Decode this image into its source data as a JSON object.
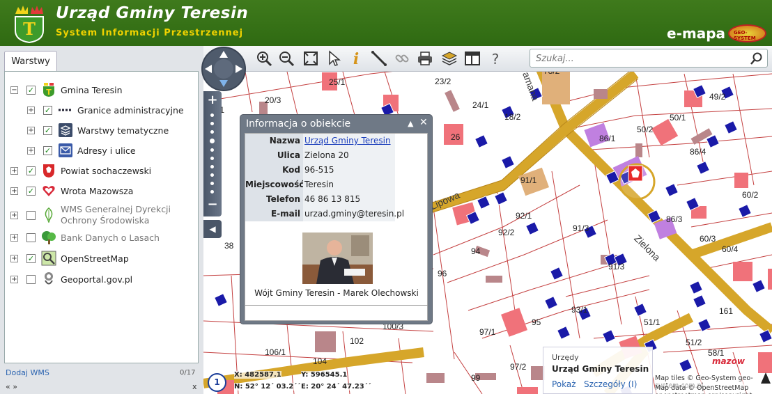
{
  "header": {
    "title": "Urząd Gminy Teresin",
    "subtitle": "System Informacji Przestrzennej",
    "brand": "e-mapa",
    "brand_badge": "GEO-SYSTEM"
  },
  "left_panel": {
    "tab": "Warstwy",
    "layers": [
      {
        "label": "Gmina Teresin",
        "expanded": true,
        "checked": true,
        "icon": "teresin-crest-icon"
      },
      {
        "label": "Granice administracyjne",
        "checked": true,
        "icon": "boundary-line-icon"
      },
      {
        "label": "Warstwy tematyczne",
        "checked": true,
        "icon": "layers-stack-icon"
      },
      {
        "label": "Adresy i ulice",
        "checked": true,
        "icon": "envelope-icon"
      },
      {
        "label": "Powiat sochaczewski",
        "checked": true,
        "icon": "powiat-crest-icon"
      },
      {
        "label": "Wrota Mazowsza",
        "checked": true,
        "icon": "heart-logo-icon"
      },
      {
        "label": "WMS Generalnej Dyrekcji Ochrony Środowiska",
        "checked": false,
        "icon": "leaf-icon"
      },
      {
        "label": "Bank Danych o Lasach",
        "checked": false,
        "icon": "tree-icon"
      },
      {
        "label": "OpenStreetMap",
        "checked": true,
        "icon": "osm-map-icon"
      },
      {
        "label": "Geoportal.gov.pl",
        "checked": false,
        "icon": "geoportal-icon"
      }
    ],
    "add_wms": "Dodaj WMS",
    "count": "0/17",
    "pager": "« »",
    "close": "x"
  },
  "search": {
    "placeholder": "Szukaj..."
  },
  "popup": {
    "title": "Informacja o obiekcie",
    "rows": [
      {
        "key": "Nazwa",
        "value": "Urząd Gminy Teresin",
        "link": true
      },
      {
        "key": "Ulica",
        "value": "Zielona 20"
      },
      {
        "key": "Kod",
        "value": "96-515"
      },
      {
        "key": "Miejscowość",
        "value": "Teresin"
      },
      {
        "key": "Telefon",
        "value": "46 86 13 815"
      },
      {
        "key": "E-mail",
        "value": "urzad.gminy@teresin.pl"
      }
    ],
    "caption": "Wójt Gminy Teresin - Marek Olechowski"
  },
  "map": {
    "street_labels": [
      "Lipowa",
      "Zielona",
      "amana"
    ],
    "parcel_labels": [
      "25/1",
      "23/2",
      "20/3",
      "24/1",
      "18/2",
      "86/1",
      "50/2",
      "50/1",
      "49/2",
      "86/4",
      "26",
      "91/1",
      "92/1",
      "92/2",
      "91/3",
      "86/3",
      "60/3",
      "60/4",
      "60/2",
      "94",
      "91/3",
      "96",
      "93/1",
      "95",
      "100/3",
      "97/1",
      "106/1",
      "102",
      "104",
      "99",
      "97/2",
      "51/1",
      "51/2",
      "161",
      "58/1",
      "38",
      "/1",
      "78/2"
    ],
    "colors": {
      "road": "#d6a62a",
      "building": "#f0727a",
      "dark_building": "#b9868a",
      "lavender": "#c080e0",
      "address": "#1a1aa8",
      "parcel": "#c44040"
    }
  },
  "coords": {
    "x": "X: 482587.1",
    "y": "Y: 596545.1",
    "n": "N: 52° 12´ 03.2´´",
    "e": "E: 20° 24´ 47.23´´"
  },
  "scale_badge": "1",
  "info_card": {
    "category": "Urzędy",
    "name": "Urząd Gminy Teresin",
    "show": "Pokaż",
    "details": "Szczegóły (I)"
  },
  "attribution": {
    "line1": "Map tiles © Geo-System geo-system.com.pl",
    "line2": "Map data © OpenStreetMap openstreetmap.org/copyright"
  },
  "corner_logo": "mazow"
}
